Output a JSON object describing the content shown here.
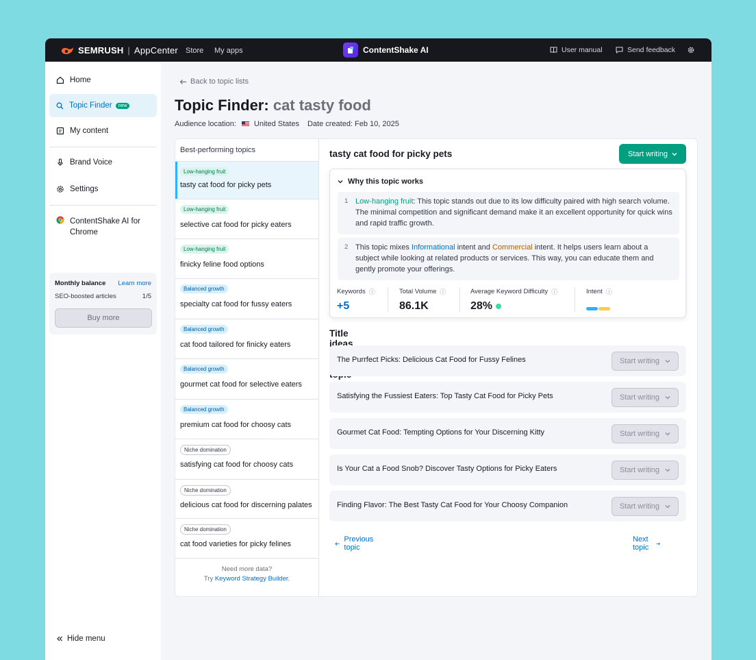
{
  "topbar": {
    "brand": "SEMRUSH",
    "appcenter": "AppCenter",
    "nav": [
      "Store",
      "My apps"
    ],
    "app_name": "ContentShake AI",
    "user_manual": "User manual",
    "send_feedback": "Send feedback"
  },
  "sidebar": {
    "home": "Home",
    "topic_finder": "Topic Finder",
    "new_badge": "new",
    "my_content": "My content",
    "brand_voice": "Brand Voice",
    "settings": "Settings",
    "chrome_line1": "ContentShake AI for",
    "chrome_line2": "Chrome",
    "balance": {
      "title": "Monthly balance",
      "learn_more": "Learn more",
      "seo_label": "SEO-boosted articles",
      "count": "1/5",
      "buy_more": "Buy more"
    },
    "hide_menu": "Hide menu"
  },
  "main": {
    "back": "Back to topic lists",
    "title_prefix": "Topic Finder:",
    "query": "cat tasty food",
    "audience_label": "Audience location:",
    "location": "United States",
    "date_created": "Date created: Feb 10, 2025"
  },
  "topics": {
    "header": "Best-performing topics",
    "items": [
      {
        "tag": "Low-hanging fruit",
        "label": "tasty cat food for picky pets"
      },
      {
        "tag": "Low-hanging fruit",
        "label": "selective cat food for picky eaters"
      },
      {
        "tag": "Low-hanging fruit",
        "label": "finicky feline food options"
      },
      {
        "tag": "Balanced growth",
        "label": "specialty cat food for fussy eaters"
      },
      {
        "tag": "Balanced growth",
        "label": "cat food tailored for finicky eaters"
      },
      {
        "tag": "Balanced growth",
        "label": "gourmet cat food for selective eaters"
      },
      {
        "tag": "Balanced growth",
        "label": "premium cat food for choosy cats"
      },
      {
        "tag": "Niche domination",
        "label": "satisfying cat food for choosy cats"
      },
      {
        "tag": "Niche domination",
        "label": "delicious cat food for discerning palates"
      },
      {
        "tag": "Niche domination",
        "label": "cat food varieties for picky felines"
      }
    ],
    "more_line1": "Need more data?",
    "more_try": "Try",
    "more_link": "Keyword Strategy Builder."
  },
  "detail": {
    "title": "tasty cat food for picky pets",
    "start_writing": "Start writing",
    "why_title": "Why this topic works",
    "reason1": {
      "num": "1",
      "highlight": "Low-hanging fruit",
      "text": ": This topic stands out due to its low difficulty paired with high search volume. The minimal competition and significant demand make it an excellent opportunity for quick wins and rapid traffic growth."
    },
    "reason2": {
      "num": "2",
      "pre": "This topic mixes ",
      "informational": "Informational",
      "mid": " intent and ",
      "commercial": "Commercial",
      "post": " intent. It helps users learn about a subject while looking at related products or services. This way, you can educate them and gently promote your offerings."
    },
    "stats": {
      "keywords_label": "Keywords",
      "keywords_value": "+5",
      "volume_label": "Total Volume",
      "volume_value": "86.1K",
      "kd_label": "Average Keyword Difficulty",
      "kd_value": "28%",
      "intent_label": "Intent"
    },
    "title_ideas_header": "Title ideas for this topic",
    "ideas": [
      "The Purrfect Picks: Delicious Cat Food for Fussy Felines",
      "Satisfying the Fussiest Eaters: Top Tasty Cat Food for Picky Pets",
      "Gourmet Cat Food: Tempting Options for Your Discerning Kitty",
      "Is Your Cat a Food Snob? Discover Tasty Options for Picky Eaters",
      "Finding Flavor: The Best Tasty Cat Food for Your Choosy Companion"
    ],
    "previous_topic": "Previous topic",
    "next_topic": "Next topic"
  },
  "colors": {
    "accent_green": "#009f81",
    "link_blue": "#006dca",
    "brand_orange": "#ff642d",
    "intent_informational": "#2bb3ff",
    "intent_commercial": "#ffcb48"
  }
}
